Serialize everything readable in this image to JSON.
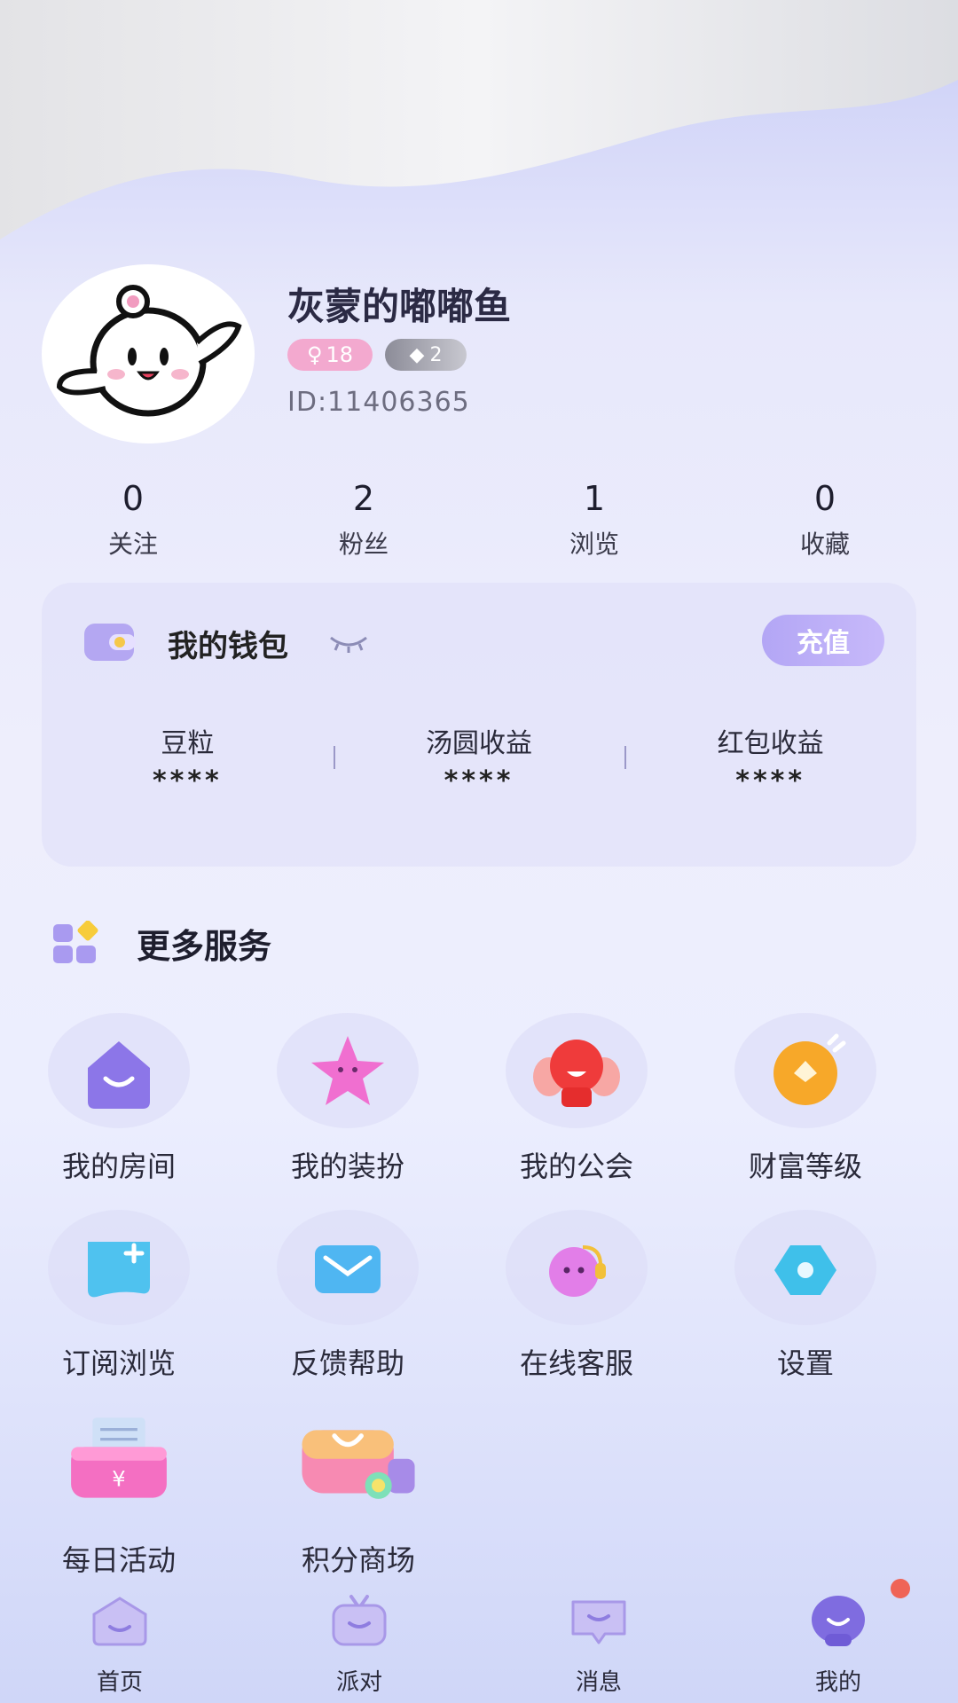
{
  "profile": {
    "nickname": "灰蒙的嘟嘟鱼",
    "gender_age": "18",
    "level": "2",
    "user_id": "ID:11406365"
  },
  "stats": [
    {
      "value": "0",
      "label": "关注"
    },
    {
      "value": "2",
      "label": "粉丝"
    },
    {
      "value": "1",
      "label": "浏览"
    },
    {
      "value": "0",
      "label": "收藏"
    }
  ],
  "wallet": {
    "title": "我的钱包",
    "recharge": "充值",
    "items": [
      {
        "label": "豆粒",
        "value": "****"
      },
      {
        "label": "汤圆收益",
        "value": "****"
      },
      {
        "label": "红包收益",
        "value": "****"
      }
    ]
  },
  "services": {
    "title": "更多服务",
    "items": [
      {
        "label": "我的房间",
        "icon": "room-icon"
      },
      {
        "label": "我的装扮",
        "icon": "dressup-icon"
      },
      {
        "label": "我的公会",
        "icon": "guild-icon"
      },
      {
        "label": "财富等级",
        "icon": "wealth-icon"
      },
      {
        "label": "订阅浏览",
        "icon": "subscribe-icon"
      },
      {
        "label": "反馈帮助",
        "icon": "feedback-icon"
      },
      {
        "label": "在线客服",
        "icon": "service-icon"
      },
      {
        "label": "设置",
        "icon": "settings-icon"
      },
      {
        "label": "每日活动",
        "icon": "daily-activity-icon"
      },
      {
        "label": "积分商场",
        "icon": "points-mall-icon"
      }
    ]
  },
  "tabbar": [
    {
      "label": "首页",
      "icon": "home-icon"
    },
    {
      "label": "派对",
      "icon": "party-tv-icon"
    },
    {
      "label": "消息",
      "icon": "message-icon"
    },
    {
      "label": "我的",
      "icon": "me-icon"
    }
  ]
}
